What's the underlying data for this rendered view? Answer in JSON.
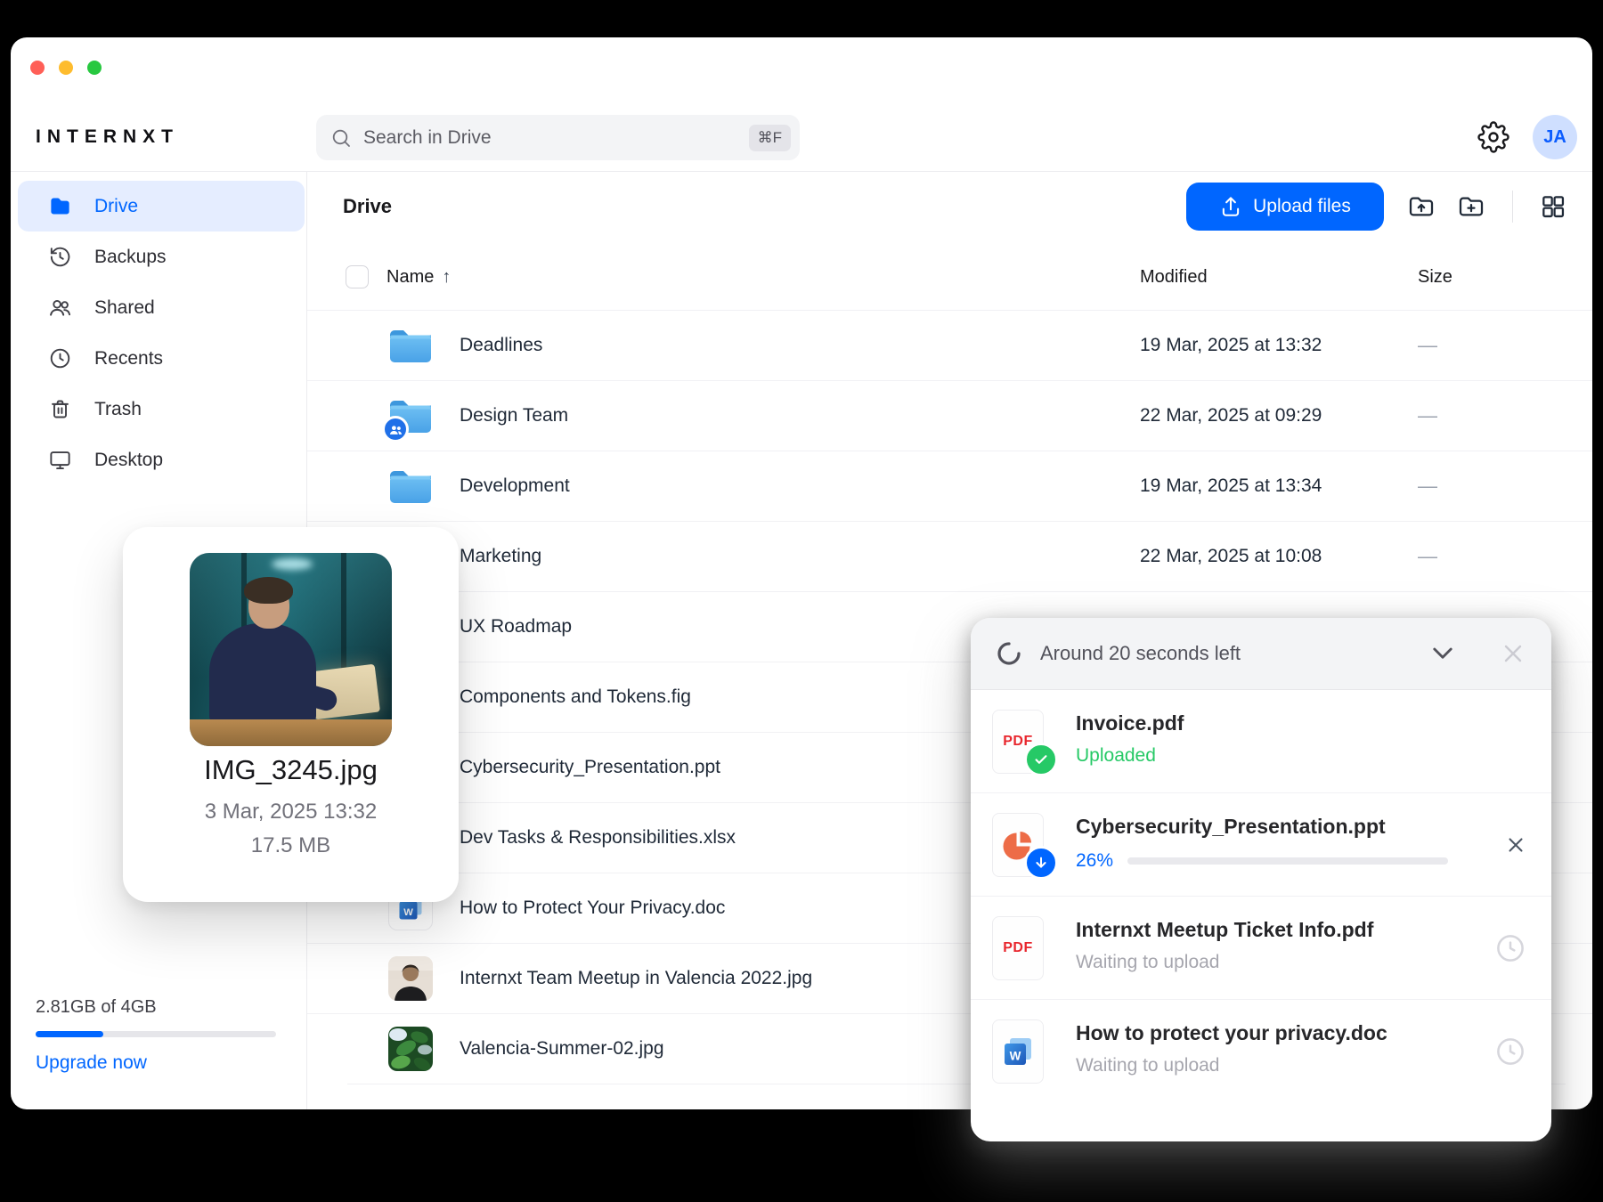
{
  "window": {
    "traffic_lights": [
      "#ff5f57",
      "#febc2e",
      "#28c840"
    ]
  },
  "brand": {
    "logo_text": "INTERNXT"
  },
  "topbar": {
    "search": {
      "placeholder": "Search in Drive",
      "shortcut": "⌘F",
      "icon": "search-icon"
    },
    "settings_icon": "gear-icon",
    "avatar_initials": "JA"
  },
  "sidebar": {
    "items": [
      {
        "label": "Drive",
        "icon": "folder-filled",
        "active": true
      },
      {
        "label": "Backups",
        "icon": "history",
        "active": false
      },
      {
        "label": "Shared",
        "icon": "users",
        "active": false
      },
      {
        "label": "Recents",
        "icon": "clock",
        "active": false
      },
      {
        "label": "Trash",
        "icon": "trash",
        "active": false
      },
      {
        "label": "Desktop",
        "icon": "monitor",
        "active": false
      }
    ],
    "storage": {
      "usage_text": "2.81GB of 4GB",
      "used_percent": 28,
      "upgrade_label": "Upgrade now"
    }
  },
  "toolbar": {
    "page_title": "Drive",
    "upload_button_label": "Upload files"
  },
  "table": {
    "columns": [
      {
        "label": "Name",
        "sort": "↑"
      },
      {
        "label": "Modified"
      },
      {
        "label": "Size"
      }
    ],
    "rows": [
      {
        "name": "Deadlines",
        "icon": "folder",
        "modified": "19 Mar, 2025 at 13:32",
        "size": "—"
      },
      {
        "name": "Design Team",
        "icon": "folder-shared",
        "modified": "22 Mar, 2025 at 09:29",
        "size": "—"
      },
      {
        "name": "Development",
        "icon": "folder",
        "modified": "19 Mar, 2025 at 13:34",
        "size": "—"
      },
      {
        "name": "Marketing",
        "icon": "folder",
        "modified": "22 Mar, 2025 at 10:08",
        "size": "—"
      },
      {
        "name": "UX Roadmap",
        "icon": "folder",
        "modified": "",
        "size": ""
      },
      {
        "name": "Components and Tokens.fig",
        "icon": "file",
        "modified": "",
        "size": ""
      },
      {
        "name": "Cybersecurity_Presentation.ppt",
        "icon": "file",
        "modified": "",
        "size": ""
      },
      {
        "name": "Dev Tasks & Responsibilities.xlsx",
        "icon": "file",
        "modified": "",
        "size": ""
      },
      {
        "name": "How to Protect Your Privacy.doc",
        "icon": "word-doc",
        "modified": "",
        "size": ""
      },
      {
        "name": "Internxt Team Meetup in Valencia 2022.jpg",
        "icon": "photo-portrait",
        "modified": "",
        "size": ""
      },
      {
        "name": "Valencia-Summer-02.jpg",
        "icon": "photo-leaves",
        "modified": "",
        "size": ""
      }
    ]
  },
  "preview_card": {
    "filename": "IMG_3245.jpg",
    "date": "3 Mar, 2025 13:32",
    "size": "17.5 MB"
  },
  "upload_panel": {
    "status_text": "Around 20 seconds left",
    "items": [
      {
        "name": "Invoice.pdf",
        "icon": "pdf",
        "badge": "check",
        "status": "Uploaded",
        "state": "done"
      },
      {
        "name": "Cybersecurity_Presentation.ppt",
        "icon": "ppt",
        "badge": "down-arrow",
        "status": "26%",
        "percent": 26,
        "state": "uploading"
      },
      {
        "name": "Internxt Meetup Ticket Info.pdf",
        "icon": "pdf",
        "status": "Waiting to upload",
        "state": "waiting"
      },
      {
        "name": "How to protect your privacy.doc",
        "icon": "word",
        "status": "Waiting to upload",
        "state": "waiting"
      }
    ]
  },
  "labels": {
    "pdf_badge": "PDF",
    "word_letter": "W"
  },
  "colors": {
    "accent": "#0066ff",
    "success": "#26c966",
    "pdf_red": "#e8262d",
    "ppt_orange": "#ed6c47",
    "word_blue": "#2b7cd3",
    "sidebar_active_bg": "#e5edff"
  }
}
